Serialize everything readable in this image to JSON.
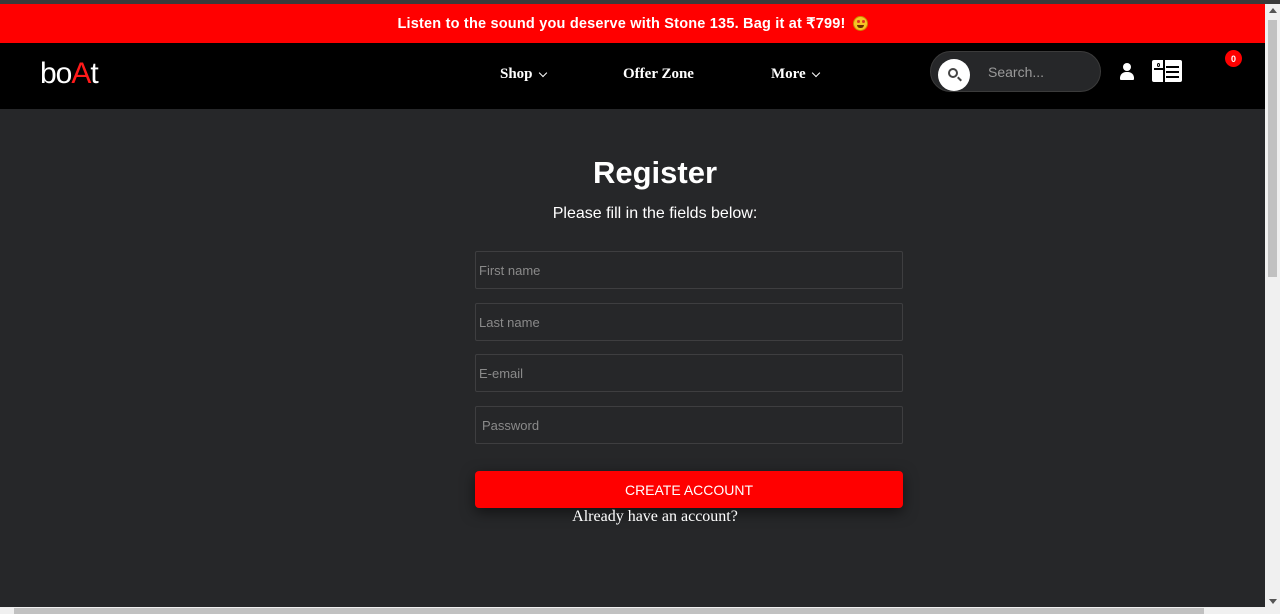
{
  "announcement": {
    "text": "Listen to the sound you deserve with Stone 135. Bag it at ₹799!",
    "emoji": "star-struck-emoji"
  },
  "navbar": {
    "logo": {
      "prefix": "bo",
      "accent": "A",
      "suffix": "t"
    },
    "items": [
      {
        "label": "Shop",
        "has_dropdown": true
      },
      {
        "label": "Offer Zone",
        "has_dropdown": false
      },
      {
        "label": "More",
        "has_dropdown": true
      }
    ],
    "search": {
      "placeholder": "Search..."
    },
    "cart_count": "0"
  },
  "form": {
    "title": "Register",
    "subtitle": "Please fill in the fields below:",
    "fields": [
      {
        "placeholder": "First name"
      },
      {
        "placeholder": "Last name"
      },
      {
        "placeholder": "E-email"
      },
      {
        "placeholder": "Password"
      }
    ],
    "submit_label": "CREATE ACCOUNT",
    "login_link": "Already have an account?"
  },
  "colors": {
    "accent": "#ff0000",
    "background": "#262729",
    "navbar": "#000000"
  }
}
